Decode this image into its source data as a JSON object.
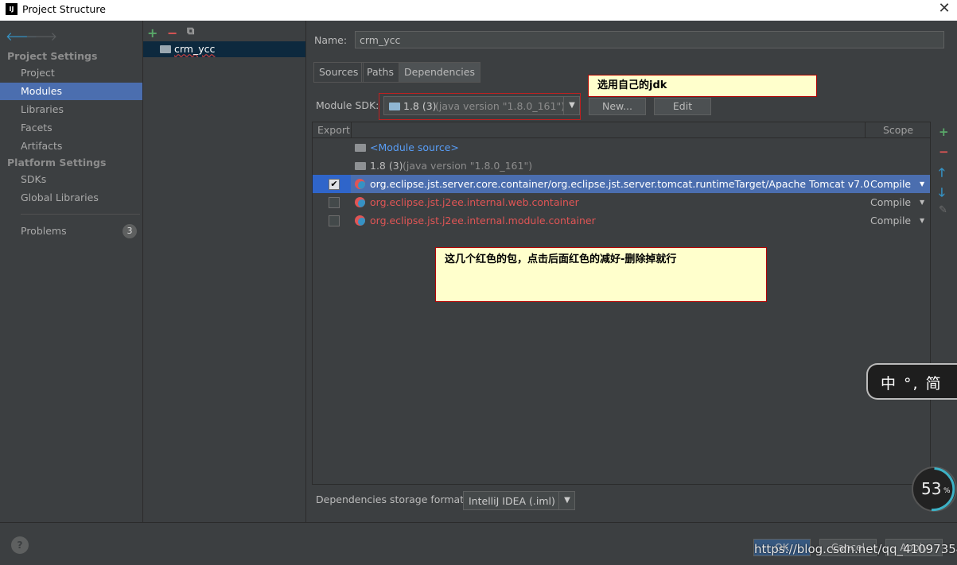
{
  "window": {
    "title": "Project Structure",
    "logo": "IJ"
  },
  "left": {
    "project_settings_header": "Project Settings",
    "project_settings": [
      "Project",
      "Modules",
      "Libraries",
      "Facets",
      "Artifacts"
    ],
    "platform_settings_header": "Platform Settings",
    "platform_settings": [
      "SDKs",
      "Global Libraries"
    ],
    "problems_label": "Problems",
    "problems_count": "3"
  },
  "middle": {
    "module_name": "crm_ycc"
  },
  "right": {
    "name_label": "Name:",
    "name_value": "crm_ycc",
    "tabs": [
      "Sources",
      "Paths",
      "Dependencies"
    ],
    "sdk_label": "Module SDK:",
    "sdk_value": "1.8 (3)",
    "sdk_hint": "(java version \"1.8.0_161\")",
    "new_button": "New...",
    "edit_button": "Edit",
    "table": {
      "col_export": "Export",
      "col_scope": "Scope",
      "module_source": "<Module source>",
      "jdk_name": "1.8 (3)",
      "jdk_hint": "(java version \"1.8.0_161\")",
      "deps": [
        {
          "name": "org.eclipse.jst.server.core.container/org.eclipse.jst.server.tomcat.runtimeTarget/Apache Tomcat v7.0",
          "scope": "Compile"
        },
        {
          "name": "org.eclipse.jst.j2ee.internal.web.container",
          "scope": "Compile"
        },
        {
          "name": "org.eclipse.jst.j2ee.internal.module.container",
          "scope": "Compile"
        }
      ]
    },
    "storage_label": "Dependencies storage format:",
    "storage_value": "IntelliJ IDEA (.iml)"
  },
  "annotations": {
    "jdk_note": "选用自己的jdk",
    "red_note": "这几个红色的包，点击后面红色的减好-删除掉就行"
  },
  "overlays": {
    "ime_text": "中 °, 简",
    "percent": "53",
    "percent_unit": "%"
  },
  "bottom": {
    "help": "?",
    "ok_button": "OK",
    "cancel_button": "Cancel",
    "apply_button": "Apply",
    "watermark": "https://blog.csdn.net/qq_41097354"
  },
  "colors": {
    "selection": "#4b6eaf",
    "red_library": "#e05555",
    "link_blue": "#589df6",
    "add_green": "#59a869"
  }
}
